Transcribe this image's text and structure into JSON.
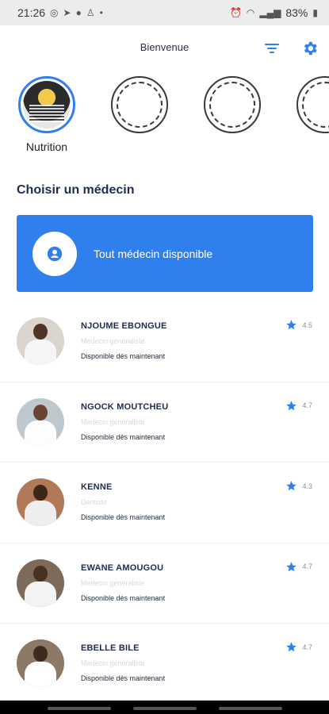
{
  "status_bar": {
    "time": "21:26",
    "battery": "83%",
    "left_icons": [
      "whatsapp-icon",
      "telegram-icon",
      "facebook-icon",
      "notification-icon",
      "dot-icon"
    ],
    "right_icons": [
      "alarm-icon",
      "wifi-icon",
      "signal-icon",
      "signal-icon",
      "battery-icon"
    ]
  },
  "header": {
    "title": "Bienvenue",
    "filter_icon": "filter-icon",
    "settings_icon": "gear-icon"
  },
  "stories": {
    "label": "Nutrition",
    "accent": "#2f80ed"
  },
  "section_title": "Choisir un médecin",
  "any_doctor": {
    "label": "Tout médecin disponible",
    "icon": "account-circle-icon",
    "color": "#2f80ed"
  },
  "doctors": [
    {
      "name": "NJOUME EBONGUE",
      "specialty": "Medecin généraliste",
      "availability": "Disponible dès maintenant",
      "rating": "4.5",
      "skin": "#4d3424",
      "coat": "#f5f5f5",
      "bg": "#d9d4ce"
    },
    {
      "name": "NGOCK MOUTCHEU",
      "specialty": "Medecin généraliste",
      "availability": "Disponible dès maintenant",
      "rating": "4.7",
      "skin": "#6a4430",
      "coat": "#fdfdfd",
      "bg": "#bfc7cf"
    },
    {
      "name": "KENNE",
      "specialty": "Dentiste",
      "availability": "Disponible dès maintenant",
      "rating": "4.3",
      "skin": "#3d2518",
      "coat": "#eeeeee",
      "bg": "#b07a58"
    },
    {
      "name": "EWANE AMOUGOU",
      "specialty": "Medecin généraliste",
      "availability": "Disponible dès maintenant",
      "rating": "4.7",
      "skin": "#4a3022",
      "coat": "#f3f3f3",
      "bg": "#7d6a58"
    },
    {
      "name": "EBELLE BILE",
      "specialty": "Medecin généraliste",
      "availability": "Disponible dès maintenant",
      "rating": "4.7",
      "skin": "#3e2a1f",
      "coat": "#ffffff",
      "bg": "#8c7a66"
    }
  ]
}
